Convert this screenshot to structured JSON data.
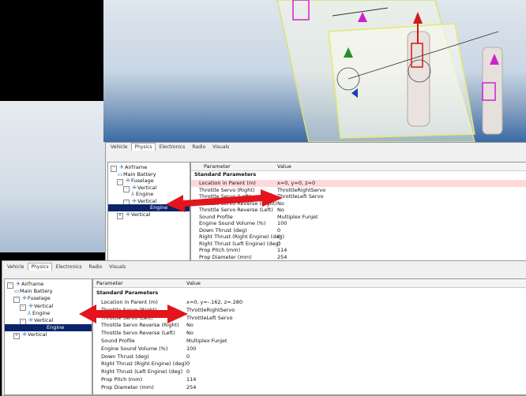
{
  "tabs": [
    "Vehicle",
    "Physics",
    "Electronics",
    "Radio",
    "Visuals"
  ],
  "active_tab": "Physics",
  "tree": [
    {
      "label": "Airframe",
      "icon": "airframe-icon",
      "glyph": "✈",
      "expander": "-",
      "level": 0
    },
    {
      "label": "Main Battery",
      "icon": "battery-icon",
      "glyph": "▭",
      "level": 1
    },
    {
      "label": "Fuselage",
      "icon": "fuselage-icon",
      "glyph": "✛",
      "expander": "-",
      "level": 1
    },
    {
      "label": "Vertical",
      "icon": "vertical-icon",
      "glyph": "✛",
      "expander": "-",
      "level": 2
    },
    {
      "label": "Engine",
      "icon": "engine-icon",
      "glyph": "⅄",
      "level": 3
    },
    {
      "label": "Vertical",
      "icon": "vertical-icon",
      "glyph": "✛",
      "expander": "-",
      "level": 2
    },
    {
      "label": "Engine",
      "icon": "engine-icon",
      "glyph": "",
      "level": 3,
      "selected": true
    },
    {
      "label": "Vertical",
      "icon": "vertical-icon",
      "glyph": "✛",
      "expander": "+",
      "level": 1
    }
  ],
  "grid": {
    "col_param": "Parameter",
    "col_value": "Value",
    "section": "Standard Parameters"
  },
  "top": {
    "rows": [
      {
        "p": "Location in Parent (m)",
        "v": "x=0, y=0, z=0"
      },
      {
        "p": "Throttle Servo (Right)",
        "v": "ThrottleRightServo"
      },
      {
        "p": "Throttle Servo (Left)",
        "v": "ThrottleLeft Servo"
      },
      {
        "p": "Throttle Servo Reverse (Right)",
        "v": "No"
      },
      {
        "p": "Throttle Servo Reverse (Left)",
        "v": "No"
      },
      {
        "p": "Sound Profile",
        "v": "Multiplex Funjet"
      },
      {
        "p": "Engine Sound Volume (%)",
        "v": "100"
      },
      {
        "p": "Down Thrust (deg)",
        "v": "0"
      },
      {
        "p": "Right Thrust (Right Engine) (deg)",
        "v": "0"
      },
      {
        "p": "Right Thrust (Left Engine) (deg)",
        "v": "0"
      },
      {
        "p": "Prop Pitch (mm)",
        "v": "114"
      },
      {
        "p": "Prop Diameter (mm)",
        "v": "254"
      }
    ]
  },
  "bottom": {
    "rows": [
      {
        "p": "Location in Parent (m)",
        "v": "x=0, y=-.162, z=.280"
      },
      {
        "p": "Throttle Servo (Right)",
        "v": "ThrottleRightServo"
      },
      {
        "p": "Throttle Servo (Left)",
        "v": "ThrottleLeft Servo"
      },
      {
        "p": "Throttle Servo Reverse (Right)",
        "v": "No"
      },
      {
        "p": "Throttle Servo Reverse (Left)",
        "v": "No"
      },
      {
        "p": "Sound Profile",
        "v": "Multiplex Funjet"
      },
      {
        "p": "Engine Sound Volume (%)",
        "v": "100"
      },
      {
        "p": "Down Thrust (deg)",
        "v": "0"
      },
      {
        "p": "Right Thrust (Right Engine) (deg)",
        "v": "0"
      },
      {
        "p": "Right Thrust (Left Engine) (deg)",
        "v": "0"
      },
      {
        "p": "Prop Pitch (mm)",
        "v": "114"
      },
      {
        "p": "Prop Diameter (mm)",
        "v": "254"
      }
    ]
  },
  "colors": {
    "arrow": "#e3141b",
    "selection": "#0a246a",
    "highlight_row": "#ffd9d9"
  }
}
